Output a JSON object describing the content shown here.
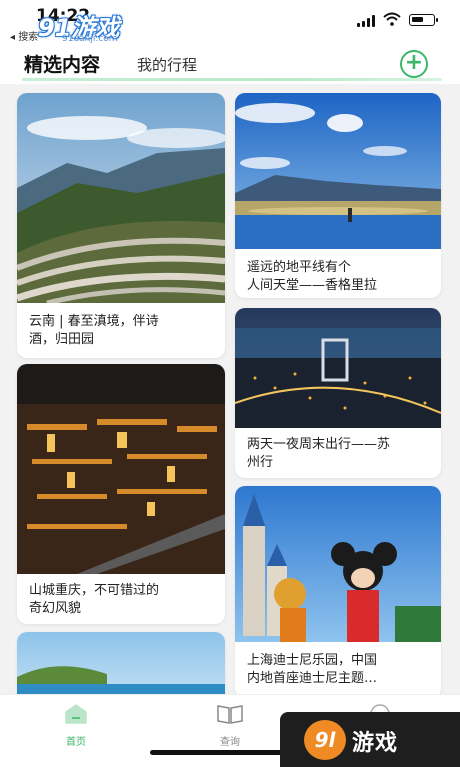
{
  "status_bar": {
    "time": "14:22",
    "back_label": "◂ 搜索",
    "watermark": "91游戏",
    "watermark_url": "91danji.com"
  },
  "tabs": {
    "selected": "精选内容",
    "other": "我的行程",
    "add_icon": "plus-circle-icon"
  },
  "cards": [
    {
      "title_line1": "云南 | 春至滇境，伴诗",
      "title_line2": "酒，归田园",
      "image": "terraced-rice-fields"
    },
    {
      "title_line1": "遥远的地平线有个",
      "title_line2": "人间天堂——香格里拉",
      "image": "lake-blue-sky"
    },
    {
      "title_line1": "两天一夜周末出行——苏",
      "title_line2": "州行",
      "image": "city-night-aerial"
    },
    {
      "title_line1": "山城重庆，不可错过的",
      "title_line2": "奇幻风貌",
      "image": "chongqing-night-buildings"
    },
    {
      "title_line1": "上海迪士尼乐园，中国",
      "title_line2": "内地首座迪士尼主题…",
      "image": "disney-castle-mickey"
    },
    {
      "title_line1": "",
      "title_line2": "",
      "image": "coast-island"
    }
  ],
  "bottom_nav": {
    "home_label": "首页",
    "query_label": "查询",
    "home_icon": "home-icon",
    "query_icon": "book-icon",
    "third_icon": "compass-icon"
  },
  "brand_logo": {
    "number": "9l",
    "text": "游戏"
  },
  "colors": {
    "accent": "#3cb66a",
    "background": "#f2f2f2"
  }
}
